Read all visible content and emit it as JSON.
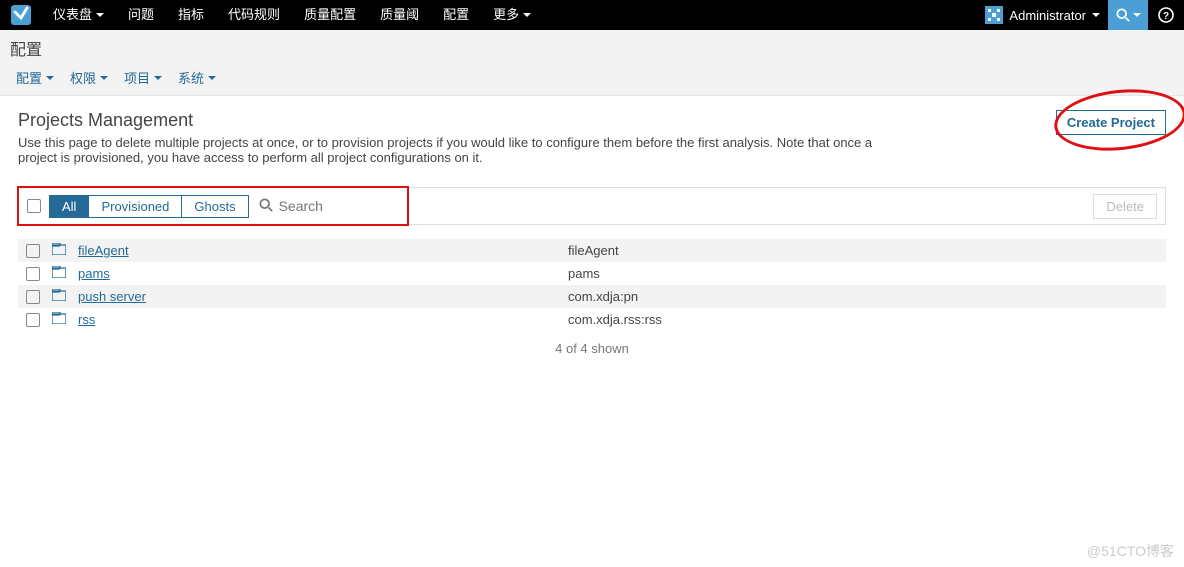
{
  "topnav": {
    "items": [
      {
        "label": "仪表盘",
        "dropdown": true
      },
      {
        "label": "问题",
        "dropdown": false
      },
      {
        "label": "指标",
        "dropdown": false
      },
      {
        "label": "代码规则",
        "dropdown": false
      },
      {
        "label": "质量配置",
        "dropdown": false
      },
      {
        "label": "质量阈",
        "dropdown": false
      },
      {
        "label": "配置",
        "dropdown": false
      },
      {
        "label": "更多",
        "dropdown": true
      }
    ],
    "user": "Administrator"
  },
  "subhead": {
    "title": "配置",
    "items": [
      {
        "label": "配置"
      },
      {
        "label": "权限"
      },
      {
        "label": "项目"
      },
      {
        "label": "系统"
      }
    ]
  },
  "page": {
    "title": "Projects Management",
    "description": "Use this page to delete multiple projects at once, or to provision projects if you would like to configure them before the first analysis. Note that once a project is provisioned, you have access to perform all project configurations on it.",
    "create_label": "Create Project"
  },
  "filters": {
    "tabs": [
      "All",
      "Provisioned",
      "Ghosts"
    ],
    "active_index": 0,
    "search_placeholder": "Search",
    "delete_label": "Delete"
  },
  "projects": [
    {
      "name": "fileAgent",
      "key": "fileAgent"
    },
    {
      "name": "pams",
      "key": "pams"
    },
    {
      "name": "push server",
      "key": "com.xdja:pn"
    },
    {
      "name": "rss",
      "key": "com.xdja.rss:rss"
    }
  ],
  "shown_text": "4 of 4 shown",
  "watermark": "@51CTO博客"
}
